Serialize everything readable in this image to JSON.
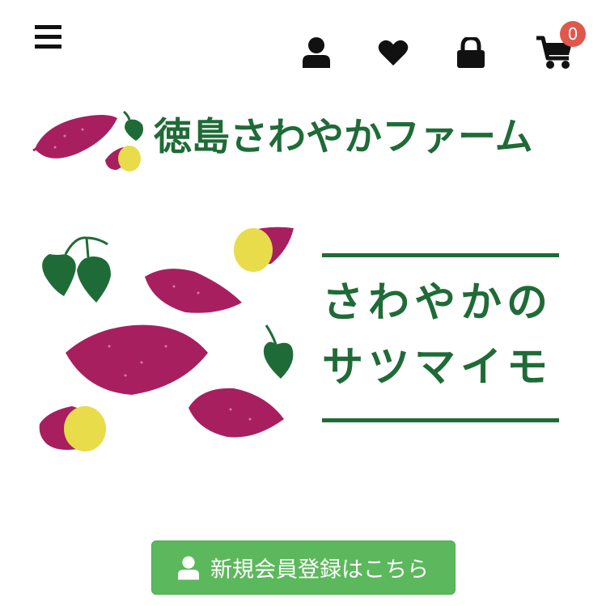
{
  "header": {
    "menu_icon": "hamburger-icon",
    "account_icon": "user-icon",
    "wishlist_icon": "heart-icon",
    "login_icon": "lock-icon",
    "cart_icon": "cart-icon",
    "cart_count": "0"
  },
  "brand": {
    "title": "徳島さわやかファーム"
  },
  "hero": {
    "line1": "さわやかの",
    "line2": "サツマイモ"
  },
  "register": {
    "label": "新規会員登録はこちら",
    "icon": "user-icon"
  },
  "colors": {
    "brand_green": "#1f6b37",
    "potato_purple": "#a81f5f",
    "potato_flesh": "#e8dc4b",
    "button_green": "#5cb85c",
    "badge_red": "#e0584d"
  }
}
